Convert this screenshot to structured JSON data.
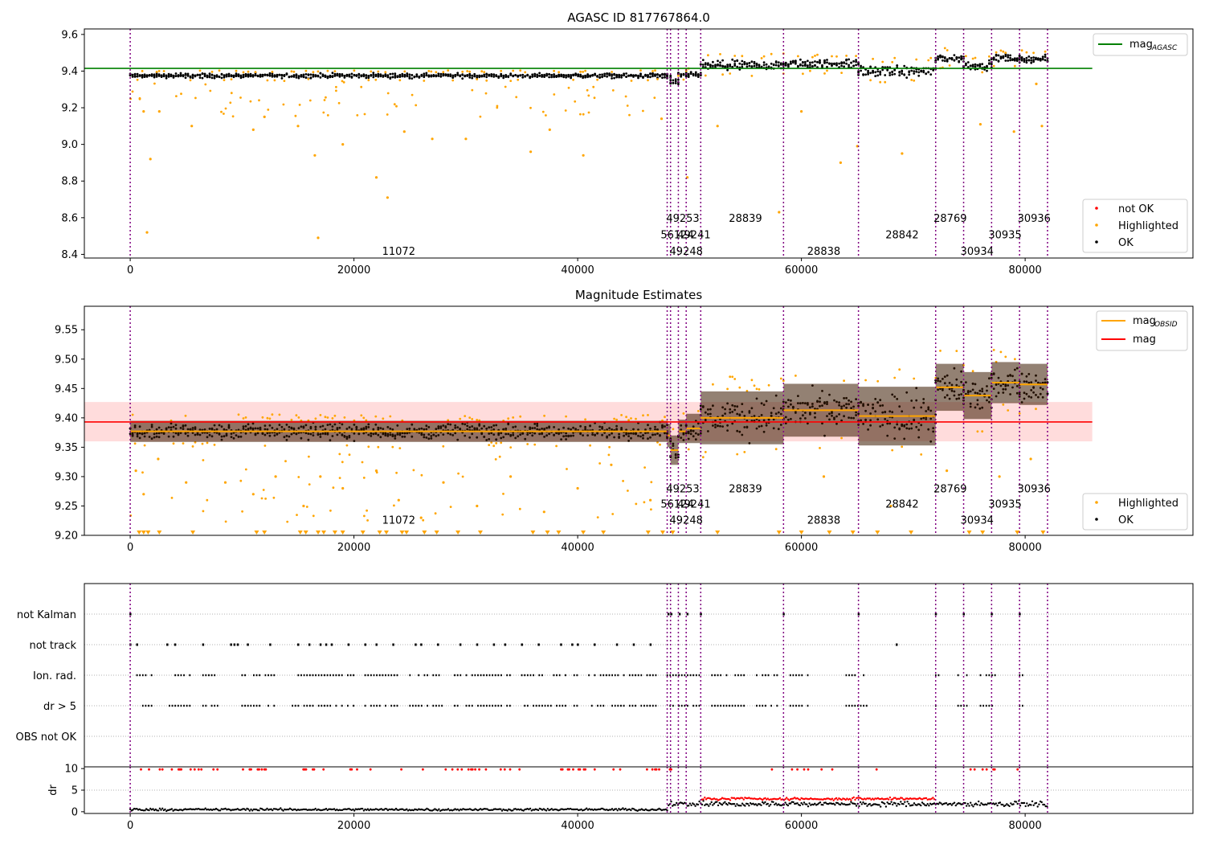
{
  "chart_data": [
    {
      "type": "scatter",
      "title": "AGASC ID 817767864.0",
      "xlim": [
        -4100,
        95000
      ],
      "ylim": [
        8.38,
        9.63
      ],
      "xticks": [
        0,
        20000,
        40000,
        60000,
        80000
      ],
      "yticks": [
        8.4,
        8.6,
        8.8,
        9.0,
        9.2,
        9.4,
        9.6
      ],
      "obs_boundaries": [
        0,
        48000,
        48300,
        49000,
        49700,
        51000,
        58400,
        65100,
        72000,
        74500,
        77000,
        79500,
        82000
      ],
      "obsid_labels": [
        {
          "text": "11072",
          "x": 24000,
          "y": 8.42
        },
        {
          "text": "49253",
          "x": 49400,
          "y": 8.6
        },
        {
          "text": "56124",
          "x": 48900,
          "y": 8.51
        },
        {
          "text": "49241",
          "x": 50400,
          "y": 8.51
        },
        {
          "text": "49248",
          "x": 49700,
          "y": 8.42
        },
        {
          "text": "28839",
          "x": 55000,
          "y": 8.6
        },
        {
          "text": "28838",
          "x": 62000,
          "y": 8.42
        },
        {
          "text": "28842",
          "x": 69000,
          "y": 8.51
        },
        {
          "text": "28769",
          "x": 73300,
          "y": 8.6
        },
        {
          "text": "30934",
          "x": 75700,
          "y": 8.42
        },
        {
          "text": "30935",
          "x": 78200,
          "y": 8.51
        },
        {
          "text": "30936",
          "x": 80800,
          "y": 8.6
        }
      ],
      "mag_agasc": 9.415,
      "line_legend": [
        {
          "name": "mag",
          "sub": "AGASC",
          "color": "#008000"
        }
      ],
      "point_legend": [
        {
          "name": "not OK",
          "color": "#ff0000"
        },
        {
          "name": "Highlighted",
          "color": "#ffa500"
        },
        {
          "name": "OK",
          "color": "#000000"
        }
      ],
      "segments": [
        {
          "x0": 0,
          "x1": 48000,
          "center": 9.375,
          "half": 0.018
        },
        {
          "x0": 48000,
          "x1": 48300,
          "center": 9.37,
          "half": 0.02
        },
        {
          "x0": 48300,
          "x1": 49000,
          "center": 9.34,
          "half": 0.025
        },
        {
          "x0": 49000,
          "x1": 49700,
          "center": 9.375,
          "half": 0.02
        },
        {
          "x0": 49700,
          "x1": 51000,
          "center": 9.38,
          "half": 0.025
        },
        {
          "x0": 51000,
          "x1": 58400,
          "center": 9.43,
          "half": 0.04
        },
        {
          "x0": 58400,
          "x1": 65100,
          "center": 9.44,
          "half": 0.035
        },
        {
          "x0": 65100,
          "x1": 72000,
          "center": 9.4,
          "half": 0.045
        },
        {
          "x0": 72000,
          "x1": 74500,
          "center": 9.47,
          "half": 0.035
        },
        {
          "x0": 74500,
          "x1": 77000,
          "center": 9.43,
          "half": 0.035
        },
        {
          "x0": 77000,
          "x1": 79500,
          "center": 9.47,
          "half": 0.03
        },
        {
          "x0": 79500,
          "x1": 82000,
          "center": 9.465,
          "half": 0.03
        }
      ],
      "outliers": [
        {
          "x": 1200,
          "y": 9.18
        },
        {
          "x": 1500,
          "y": 8.52
        },
        {
          "x": 1800,
          "y": 8.92
        },
        {
          "x": 2600,
          "y": 9.18
        },
        {
          "x": 5500,
          "y": 9.1
        },
        {
          "x": 11000,
          "y": 9.08
        },
        {
          "x": 12000,
          "y": 9.15
        },
        {
          "x": 15000,
          "y": 9.1
        },
        {
          "x": 16500,
          "y": 8.94
        },
        {
          "x": 16800,
          "y": 8.49
        },
        {
          "x": 19000,
          "y": 9.0
        },
        {
          "x": 22000,
          "y": 8.82
        },
        {
          "x": 23000,
          "y": 8.71
        },
        {
          "x": 24500,
          "y": 9.07
        },
        {
          "x": 27000,
          "y": 9.03
        },
        {
          "x": 30000,
          "y": 9.03
        },
        {
          "x": 35800,
          "y": 8.96
        },
        {
          "x": 37500,
          "y": 9.08
        },
        {
          "x": 40500,
          "y": 8.94
        },
        {
          "x": 47500,
          "y": 9.14
        },
        {
          "x": 49800,
          "y": 8.82
        },
        {
          "x": 52500,
          "y": 9.1
        },
        {
          "x": 58000,
          "y": 8.63
        },
        {
          "x": 60000,
          "y": 9.18
        },
        {
          "x": 63500,
          "y": 8.9
        },
        {
          "x": 65000,
          "y": 8.99
        },
        {
          "x": 69000,
          "y": 8.95
        },
        {
          "x": 76000,
          "y": 9.11
        },
        {
          "x": 79000,
          "y": 9.07
        },
        {
          "x": 81000,
          "y": 9.33
        },
        {
          "x": 81500,
          "y": 9.1
        }
      ]
    },
    {
      "type": "scatter",
      "title": "Magnitude Estimates",
      "xlim": [
        -4100,
        95000
      ],
      "ylim": [
        9.2,
        9.59
      ],
      "xticks": [
        0,
        20000,
        40000,
        60000,
        80000
      ],
      "yticks": [
        9.2,
        9.25,
        9.3,
        9.35,
        9.4,
        9.45,
        9.5,
        9.55
      ],
      "mag": 9.393,
      "mag_band": [
        9.36,
        9.427
      ],
      "line_legend": [
        {
          "name": "mag",
          "sub": "OBSID",
          "color": "#ffa500"
        },
        {
          "name": "mag",
          "sub": "",
          "color": "#ff0000"
        }
      ],
      "point_legend": [
        {
          "name": "Highlighted",
          "color": "#ffa500"
        },
        {
          "name": "OK",
          "color": "#000000"
        }
      ],
      "segments": [
        {
          "x0": 0,
          "x1": 48000,
          "center": 9.377,
          "half": 0.018
        },
        {
          "x0": 48000,
          "x1": 48300,
          "center": 9.37,
          "half": 0.02
        },
        {
          "x0": 48300,
          "x1": 49000,
          "center": 9.345,
          "half": 0.025
        },
        {
          "x0": 49000,
          "x1": 49700,
          "center": 9.377,
          "half": 0.02
        },
        {
          "x0": 49700,
          "x1": 51000,
          "center": 9.382,
          "half": 0.025
        },
        {
          "x0": 51000,
          "x1": 58400,
          "center": 9.4,
          "half": 0.045
        },
        {
          "x0": 58400,
          "x1": 65100,
          "center": 9.413,
          "half": 0.045
        },
        {
          "x0": 65100,
          "x1": 72000,
          "center": 9.403,
          "half": 0.05
        },
        {
          "x0": 72000,
          "x1": 74500,
          "center": 9.452,
          "half": 0.04
        },
        {
          "x0": 74500,
          "x1": 77000,
          "center": 9.438,
          "half": 0.04
        },
        {
          "x0": 77000,
          "x1": 79500,
          "center": 9.46,
          "half": 0.035
        },
        {
          "x0": 79500,
          "x1": 82000,
          "center": 9.457,
          "half": 0.035
        }
      ],
      "outliers": [
        {
          "x": 500,
          "y": 9.31
        },
        {
          "x": 1200,
          "y": 9.27
        },
        {
          "x": 2500,
          "y": 9.33
        },
        {
          "x": 5000,
          "y": 9.29
        },
        {
          "x": 8500,
          "y": 9.29
        },
        {
          "x": 11000,
          "y": 9.27
        },
        {
          "x": 13000,
          "y": 9.3
        },
        {
          "x": 15500,
          "y": 9.25
        },
        {
          "x": 17000,
          "y": 9.3
        },
        {
          "x": 19000,
          "y": 9.28
        },
        {
          "x": 22000,
          "y": 9.31
        },
        {
          "x": 24000,
          "y": 9.26
        },
        {
          "x": 26000,
          "y": 9.23
        },
        {
          "x": 28000,
          "y": 9.29
        },
        {
          "x": 31000,
          "y": 9.25
        },
        {
          "x": 34000,
          "y": 9.3
        },
        {
          "x": 37000,
          "y": 9.24
        },
        {
          "x": 40000,
          "y": 9.28
        },
        {
          "x": 43000,
          "y": 9.32
        },
        {
          "x": 46500,
          "y": 9.26
        },
        {
          "x": 62000,
          "y": 9.3
        },
        {
          "x": 68000,
          "y": 9.25
        },
        {
          "x": 73000,
          "y": 9.31
        },
        {
          "x": 77700,
          "y": 9.3
        },
        {
          "x": 80500,
          "y": 9.33
        }
      ],
      "clipped_x": [
        800,
        1200,
        1600,
        2600,
        5600,
        11300,
        12000,
        15200,
        15700,
        16800,
        17300,
        18300,
        19000,
        20800,
        22300,
        22900,
        24300,
        24700,
        26300,
        27400,
        29300,
        31300,
        36000,
        37300,
        38300,
        40500,
        42300,
        46300,
        47600,
        48500,
        52500,
        58000,
        60000,
        62500,
        64600,
        66800,
        69800,
        75000,
        76200,
        79300,
        81600
      ]
    },
    {
      "type": "scatter",
      "title": "",
      "xlim": [
        -4100,
        95000
      ],
      "xticks": [
        0,
        20000,
        40000,
        60000,
        80000
      ],
      "categories": [
        "not Kalman",
        "not track",
        "Ion. rad.",
        "dr > 5",
        "OBS not OK"
      ],
      "flag_points": {
        "not Kalman": [
          0,
          48100,
          48350,
          49100,
          49800,
          51000,
          58400,
          65100,
          72000,
          74500,
          77000,
          79500
        ],
        "not track": [
          0,
          600,
          3300,
          4000,
          6500,
          9000,
          9300,
          9600,
          10500,
          12500,
          15000,
          16000,
          17000,
          17500,
          18000,
          19500,
          21000,
          22000,
          23500,
          25500,
          26000,
          27500,
          29500,
          31000,
          32500,
          33500,
          35000,
          36500,
          38500,
          39500,
          40000,
          41500,
          43500,
          45000,
          46500,
          68500
        ],
        "ion_rad_ranges": [
          [
            600,
            2000
          ],
          [
            3500,
            5500
          ],
          [
            6500,
            8000
          ],
          [
            10000,
            13000
          ],
          [
            14500,
            20000
          ],
          [
            21000,
            24000
          ],
          [
            25000,
            28000
          ],
          [
            29000,
            34000
          ],
          [
            35000,
            40000
          ],
          [
            41000,
            47000
          ],
          [
            48000,
            51000
          ],
          [
            52000,
            55000
          ],
          [
            56000,
            58000
          ],
          [
            59000,
            61000
          ],
          [
            64000,
            66000
          ],
          [
            72000,
            72500
          ],
          [
            74000,
            75000
          ],
          [
            76000,
            77500
          ],
          [
            79500,
            80000
          ]
        ],
        "dr5_ranges": [
          [
            600,
            2000
          ],
          [
            3500,
            5500
          ],
          [
            6500,
            8000
          ],
          [
            10000,
            13000
          ],
          [
            14500,
            20000
          ],
          [
            21000,
            24000
          ],
          [
            25000,
            28000
          ],
          [
            29000,
            34000
          ],
          [
            35000,
            40000
          ],
          [
            41000,
            47000
          ],
          [
            48000,
            51000
          ],
          [
            52000,
            55000
          ],
          [
            56000,
            58000
          ],
          [
            59000,
            61000
          ],
          [
            64000,
            66000
          ],
          [
            72000,
            72500
          ],
          [
            74000,
            75000
          ],
          [
            76000,
            77500
          ],
          [
            79500,
            80000
          ]
        ]
      }
    },
    {
      "type": "scatter",
      "title": "",
      "ylabel": "dr",
      "xlim": [
        -4100,
        95000
      ],
      "ylim": [
        -0.4,
        10.4
      ],
      "xticks": [
        0,
        20000,
        40000,
        60000,
        80000
      ],
      "yticks": [
        0,
        5,
        10
      ],
      "tick_labels_y": [
        "0",
        "5",
        "10"
      ],
      "dr_levels": {
        "base_early": 0.5,
        "base_late": 1.8,
        "red_band": 3.0,
        "clip": 9.8
      }
    }
  ],
  "xtick_labels": [
    "0",
    "20000",
    "40000",
    "60000",
    "80000"
  ]
}
